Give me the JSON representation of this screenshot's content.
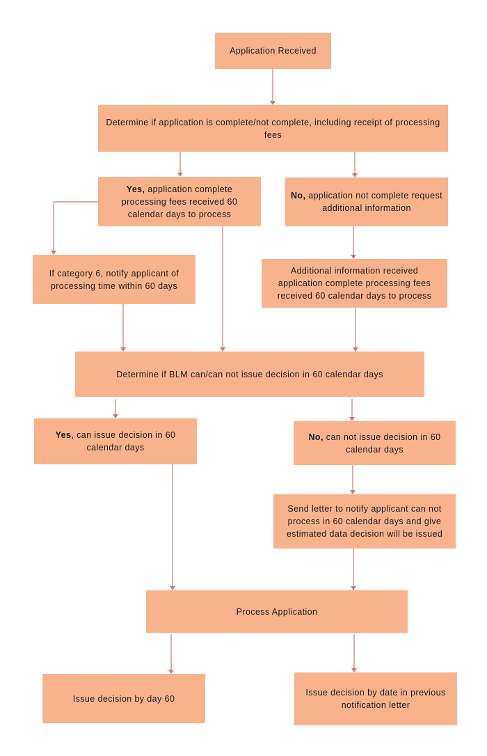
{
  "diagram": {
    "type": "flowchart",
    "colors": {
      "node_fill": "#f8b38d",
      "edge": "#c9797a",
      "text": "#1a1a1a",
      "background": "#ffffff"
    },
    "nodes": {
      "received": {
        "bold": "",
        "text": "Application Received"
      },
      "determine": {
        "bold": "",
        "text": "Determine if application is complete/not complete, including receipt of processing fees"
      },
      "yes": {
        "bold": "Yes,",
        "text": " application complete processing fees received 60 calendar days to process"
      },
      "no": {
        "bold": "No,",
        "text": " application not complete request additional information"
      },
      "category6": {
        "bold": "",
        "text": "If category 6, notify applicant  of processing time within 60 days"
      },
      "addinfo": {
        "bold": "",
        "text": "Additional information received application complete processing fees received 60 calendar days to process"
      },
      "blm": {
        "bold": "",
        "text": "Determine if BLM can/can not issue decision in 60 calendar days"
      },
      "yescan": {
        "bold": "Yes",
        "text": ", can issue decision in 60 calendar days"
      },
      "nocan": {
        "bold": "No,",
        "text": " can not issue decision in 60 calendar days"
      },
      "sendletter": {
        "bold": "",
        "text": "Send letter to notify applicant can not process in 60 calendar days and give estimated data decision will be issued"
      },
      "process": {
        "bold": "",
        "text": "Process Application"
      },
      "day60": {
        "bold": "",
        "text": "Issue decision by day 60"
      },
      "bydate": {
        "bold": "",
        "text": "Issue decision by date in previous notification letter"
      }
    },
    "edges": [
      {
        "from": "received",
        "to": "determine"
      },
      {
        "from": "determine",
        "to": "yes"
      },
      {
        "from": "determine",
        "to": "no"
      },
      {
        "from": "yes",
        "to": "category6"
      },
      {
        "from": "yes",
        "to": "blm"
      },
      {
        "from": "no",
        "to": "addinfo"
      },
      {
        "from": "category6",
        "to": "blm"
      },
      {
        "from": "addinfo",
        "to": "blm"
      },
      {
        "from": "blm",
        "to": "yescan"
      },
      {
        "from": "blm",
        "to": "nocan"
      },
      {
        "from": "nocan",
        "to": "sendletter"
      },
      {
        "from": "yescan",
        "to": "process"
      },
      {
        "from": "sendletter",
        "to": "process"
      },
      {
        "from": "process",
        "to": "day60"
      },
      {
        "from": "process",
        "to": "bydate"
      }
    ]
  }
}
